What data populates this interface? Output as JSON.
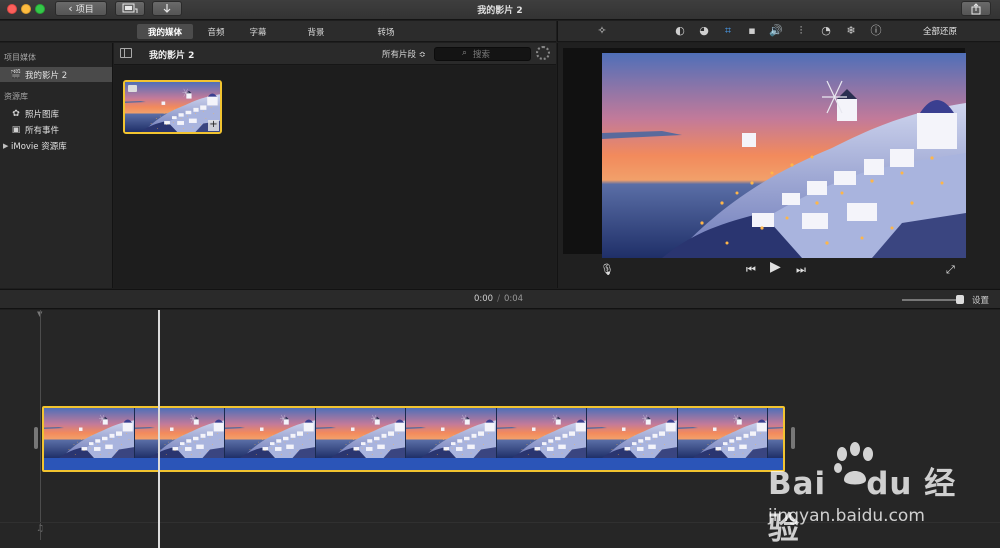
{
  "window": {
    "title": "我的影片 2"
  },
  "toolbar": {
    "projects_label": "项目",
    "media_icon": "film-clip-icon",
    "import_icon": "import-arrow-icon",
    "share_icon": "share-icon"
  },
  "tabs": [
    {
      "label": "我的媒体",
      "active": true
    },
    {
      "label": "音频",
      "active": false
    },
    {
      "label": "字幕",
      "active": false
    },
    {
      "label": "背景",
      "active": false
    },
    {
      "label": "转场",
      "active": false
    }
  ],
  "sidebar": {
    "project_media_heading": "项目媒体",
    "project_item": "我的影片 2",
    "libraries_heading": "资源库",
    "library_items": [
      "照片图库",
      "所有事件",
      "iMovie 资源库"
    ]
  },
  "browser": {
    "title": "我的影片 2",
    "filter_label": "所有片段 ≎",
    "search_placeholder": "搜索"
  },
  "viewer": {
    "tools": [
      "magic-wand-icon",
      "color-balance-icon",
      "color-correction-icon",
      "crop-icon",
      "stabilization-icon",
      "volume-icon",
      "noise-reduction-icon",
      "speed-icon",
      "filter-icon",
      "info-icon"
    ],
    "active_tool": "crop-icon",
    "reset_all_label": "全部还原"
  },
  "timeline": {
    "current_time": "0:00",
    "total_time": "0:04",
    "settings_label": "设置",
    "zoom_level": 0.9
  },
  "watermark": {
    "logo_text_1": "Bai",
    "logo_text_2": "du 经验",
    "url": "jingyan.baidu.com"
  },
  "colors": {
    "clip_border": "#f2c430",
    "audio_track": "#2b55b8",
    "active_tool": "#4a9ef0"
  }
}
